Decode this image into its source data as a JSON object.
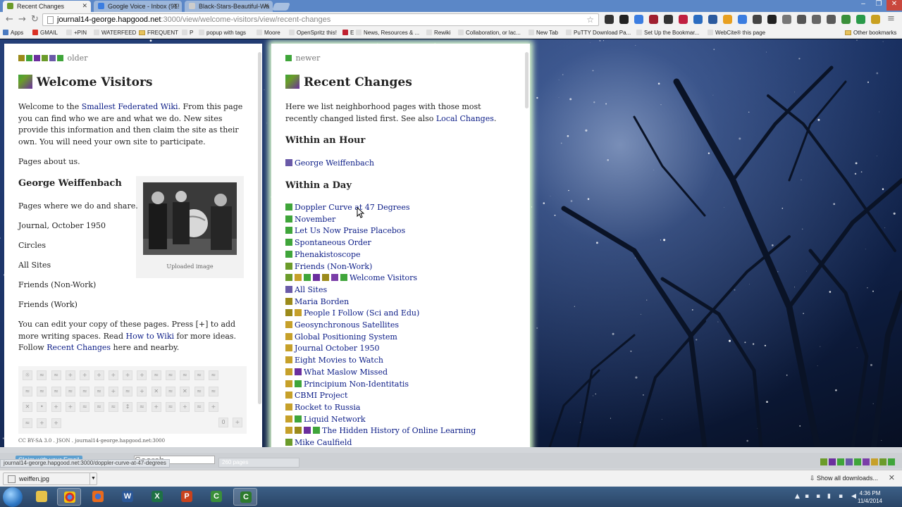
{
  "browser": {
    "tabs": [
      {
        "label": "Recent Changes",
        "icon_color": "#6b9b2a",
        "active": true
      },
      {
        "label": "Google Voice - Inbox (91!",
        "icon_color": "#3b7de0",
        "active": false
      },
      {
        "label": "Black-Stars-Beautiful-Wa",
        "icon_color": "#cccccc",
        "active": false
      }
    ],
    "url_host": "journal14-george.hapgood.net",
    "url_rest": ":3000/view/welcome-visitors/view/recent-changes",
    "bookmarks": [
      {
        "label": "Apps",
        "icon": "apps-grid-icon"
      },
      {
        "label": "GMAIL",
        "icon": "gmail-icon"
      },
      {
        "label": "+PIN",
        "icon": "page-icon"
      },
      {
        "label": "WATERFEED",
        "icon": "page-icon"
      },
      {
        "label": "FREQUENT",
        "icon": "folder-icon"
      },
      {
        "label": "P",
        "icon": "page-icon"
      },
      {
        "label": "popup with tags",
        "icon": "page-icon"
      },
      {
        "label": "Moore",
        "icon": "page-icon"
      },
      {
        "label": "OpenSpritz this!",
        "icon": "page-icon"
      },
      {
        "label": "E",
        "icon": "e-icon"
      },
      {
        "label": "News, Resources & ...",
        "icon": "page-icon"
      },
      {
        "label": "Rewiki",
        "icon": "page-icon"
      },
      {
        "label": "Collaboration, or lac...",
        "icon": "page-icon"
      },
      {
        "label": "New Tab",
        "icon": "page-icon"
      },
      {
        "label": "PuTTY Download Pa...",
        "icon": "page-icon"
      },
      {
        "label": "Set Up the Bookmar...",
        "icon": "page-icon"
      },
      {
        "label": "WebCite® this page",
        "icon": "page-icon"
      }
    ],
    "other_bookmarks": "Other bookmarks"
  },
  "left_page": {
    "twins_label": "older",
    "title": "Welcome Visitors",
    "intro_prefix": "Welcome to the ",
    "intro_link": "Smallest Federated Wiki",
    "intro_suffix": ". From this page you can find who we are and what we do. New sites provide this information and then claim the site as their own. You will need your own site to participate.",
    "pages_about_us": "Pages about us.",
    "author_link": "George Weiffenbach",
    "pages_where": "Pages where we do and share.",
    "journal_link": "Journal, October 1950",
    "circles": "Circles",
    "all_sites": "All Sites",
    "friends_nonwork": "Friends (Non-Work)",
    "friends_work": "Friends (Work)",
    "edit_text_1": "You can edit your copy of these pages. Press [+] to add more writing spaces. Read ",
    "edit_link_1": "How to Wiki",
    "edit_text_2": " for more ideas. Follow ",
    "edit_link_2": "Recent Changes",
    "edit_text_3": " here and nearby.",
    "photo_caption": "Uploaded image",
    "license": "CC BY-SA 3.0 . JSON . journal14-george.hapgood.net:3000"
  },
  "right_page": {
    "twins_label": "newer",
    "title": "Recent Changes",
    "intro_text": "Here we list neighborhood pages with those most recently changed listed first. See also ",
    "intro_link": "Local Changes",
    "intro_end": ".",
    "section_hour": "Within an Hour",
    "hour_items": [
      {
        "label": "George Weiffenbach",
        "flags": [
          "#6a5aa8"
        ]
      }
    ],
    "section_day": "Within a Day",
    "day_items": [
      {
        "label": "Doppler Curve at 47 Degrees",
        "flags": [
          "#3fa53a"
        ]
      },
      {
        "label": "November",
        "flags": [
          "#3fa53a"
        ]
      },
      {
        "label": "Let Us Now Praise Placebos",
        "flags": [
          "#3fa53a"
        ]
      },
      {
        "label": "Spontaneous Order",
        "flags": [
          "#3fa53a"
        ]
      },
      {
        "label": "Phenakistoscope",
        "flags": [
          "#3fa53a"
        ]
      },
      {
        "label": "Friends (Non-Work)",
        "flags": [
          "#6b9b2a"
        ]
      },
      {
        "label": "Welcome Visitors",
        "flags": [
          "#6b9b2a",
          "#c6a02a",
          "#3fa53a",
          "#6b2f9e",
          "#9b8a1a",
          "#7a3ea8",
          "#3fa53a"
        ]
      },
      {
        "label": "All Sites",
        "flags": [
          "#6a5aa8"
        ]
      },
      {
        "label": "Maria Borden",
        "flags": [
          "#9b8a1a"
        ]
      },
      {
        "label": "People I Follow (Sci and Edu)",
        "flags": [
          "#9b8a1a",
          "#c6a02a"
        ]
      },
      {
        "label": "Geosynchronous Satellites",
        "flags": [
          "#c6a02a"
        ]
      },
      {
        "label": "Global Positioning System",
        "flags": [
          "#c6a02a"
        ]
      },
      {
        "label": "Journal October 1950",
        "flags": [
          "#c6a02a"
        ]
      },
      {
        "label": "Eight Movies to Watch",
        "flags": [
          "#c6a02a"
        ]
      },
      {
        "label": "What Maslow Missed",
        "flags": [
          "#c6a02a",
          "#6b2f9e"
        ]
      },
      {
        "label": "Principium Non-Identitatis",
        "flags": [
          "#c6a02a",
          "#3fa53a"
        ]
      },
      {
        "label": "CBMI Project",
        "flags": [
          "#c6a02a"
        ]
      },
      {
        "label": "Rocket to Russia",
        "flags": [
          "#c6a02a"
        ]
      },
      {
        "label": "Liquid Network",
        "flags": [
          "#c6a02a",
          "#3fa53a"
        ]
      },
      {
        "label": "The Hidden History of Online Learning",
        "flags": [
          "#c6a02a",
          "#9b8a1a",
          "#6b2f9e",
          "#3fa53a"
        ]
      },
      {
        "label": "Mike Caulfield",
        "flags": [
          "#6b9b2a"
        ]
      }
    ]
  },
  "wiki_footer": {
    "claim_label": "Claim with your Email",
    "search_placeholder": "Search",
    "status_url": "journal14-george.hapgood.net:3000/doppler-curve-at-47-degrees",
    "page_count": "260 pages"
  },
  "downloads": {
    "file_name": "weiffen.jpg",
    "show_all": "Show all downloads..."
  },
  "taskbar": {
    "time": "4:36 PM",
    "date": "11/4/2014"
  },
  "colors": {
    "link": "#0a1b86",
    "accent_green": "#3fa53a",
    "active_glow": "#dfffd0"
  }
}
